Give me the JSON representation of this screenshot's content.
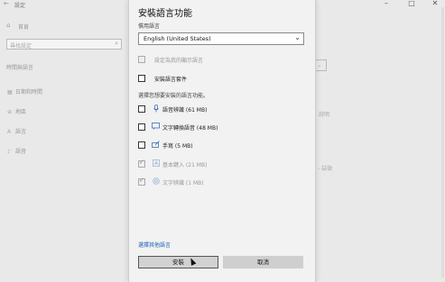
{
  "background": {
    "window_title": "設定",
    "home_label": "首頁",
    "search_placeholder": "尋找設定",
    "section_title": "時間與語言",
    "nav_items": [
      {
        "icon": "calendar-icon",
        "glyph": "▦",
        "label": "日期和時間"
      },
      {
        "icon": "globe-icon",
        "glyph": "⊕",
        "label": "地區"
      },
      {
        "icon": "language-icon",
        "glyph": "A",
        "label": "語言"
      },
      {
        "icon": "microphone-icon",
        "glyph": "♪",
        "label": "語音"
      }
    ],
    "right_fragments": [
      "說明",
      "- 喆微"
    ]
  },
  "dialog": {
    "title": "安裝語言功能",
    "preferred_language_label": "慣用語言",
    "selected_language": "English (United States)",
    "options_top": [
      {
        "label": "設定為我的顯示語言",
        "checked": false,
        "disabled": true
      },
      {
        "label": "安裝語言套件",
        "checked": false,
        "disabled": false
      }
    ],
    "section_label": "選擇您想要安裝的語言功能。",
    "features": [
      {
        "icon": "microphone-icon",
        "glyph": "🎙",
        "label": "語音辨識 (61 MB)",
        "checked": false,
        "disabled": false
      },
      {
        "icon": "text-to-speech-icon",
        "glyph": "▭",
        "label": "文字轉換語音 (48 MB)",
        "checked": false,
        "disabled": false
      },
      {
        "icon": "handwriting-icon",
        "glyph": "✎",
        "label": "手寫 (5 MB)",
        "checked": false,
        "disabled": false
      },
      {
        "icon": "typing-icon",
        "glyph": "A",
        "label": "基本鍵入 (21 MB)",
        "checked": true,
        "disabled": true
      },
      {
        "icon": "ocr-icon",
        "glyph": "◎",
        "label": "文字辨識 (1 MB)",
        "checked": true,
        "disabled": true
      }
    ],
    "link_label": "選擇其他語言",
    "install_button": "安裝",
    "cancel_button": "取消"
  }
}
